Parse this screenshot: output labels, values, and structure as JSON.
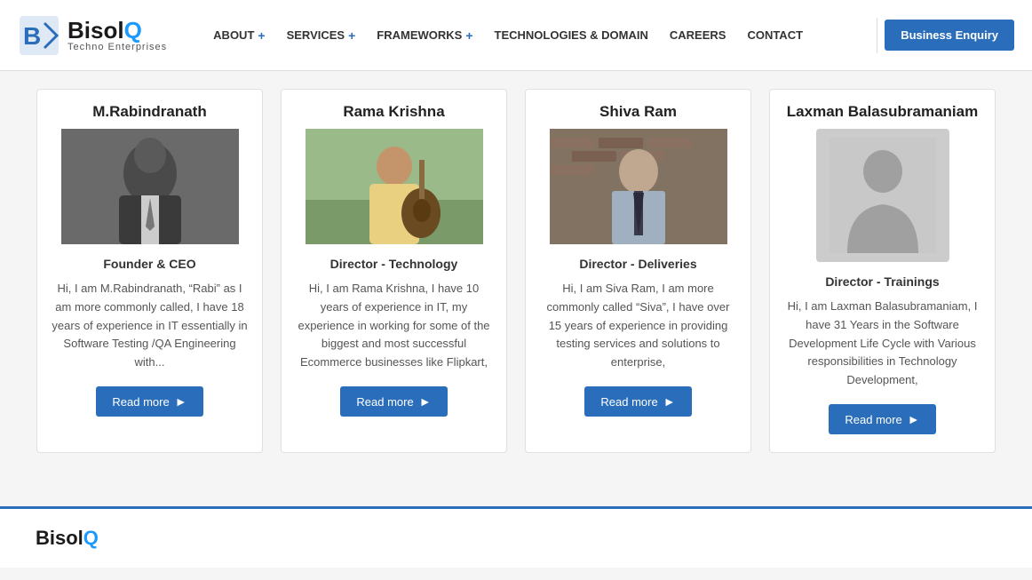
{
  "header": {
    "logo_brand": "Bisol",
    "logo_brand_q": "Q",
    "logo_sub": "Techno Enterprises",
    "nav_items": [
      {
        "label": "ABOUT",
        "has_plus": true
      },
      {
        "label": "SERVICES",
        "has_plus": true
      },
      {
        "label": "FRAMEWORKS",
        "has_plus": true
      },
      {
        "label": "TECHNOLOGIES & DOMAIN",
        "has_plus": false
      },
      {
        "label": "CAREERS",
        "has_plus": false
      },
      {
        "label": "CONTACT",
        "has_plus": false
      }
    ],
    "enquiry_btn": "Business Enquiry"
  },
  "team": [
    {
      "name": "M.Rabindranath",
      "role": "Founder & CEO",
      "desc": "Hi, I am M.Rabindranath, “Rabi” as I am more commonly called, I have 18 years of experience in IT essentially in Software Testing /QA Engineering with...",
      "read_more": "Read more",
      "photo_type": "person1"
    },
    {
      "name": "Rama Krishna",
      "role": "Director - Technology",
      "desc": "Hi, I am Rama Krishna, I have 10 years of experience in IT, my experience in working for some of the biggest and most successful Ecommerce businesses like Flipkart,",
      "read_more": "Read more",
      "photo_type": "person2"
    },
    {
      "name": "Shiva Ram",
      "role": "Director - Deliveries",
      "desc": "Hi, I am Siva Ram, I am more commonly called “Siva”, I have over 15 years of experience in providing testing services and solutions to enterprise,",
      "read_more": "Read more",
      "photo_type": "person3"
    },
    {
      "name": "Laxman Balasubramaniam",
      "role": "Director - Trainings",
      "desc": "Hi, I am Laxman Balasubramaniam, I have 31 Years in the Software Development Life Cycle with Various responsibilities in Technology Development,",
      "read_more": "Read more",
      "photo_type": "silhouette"
    }
  ],
  "footer": {
    "logo_brand": "Bisol",
    "logo_brand_q": "Q"
  }
}
